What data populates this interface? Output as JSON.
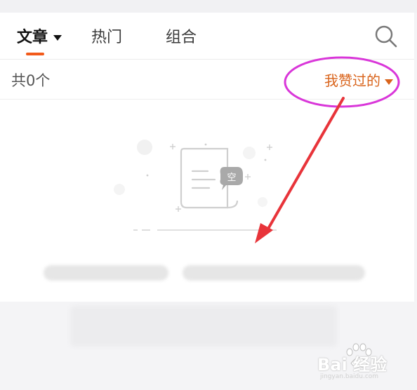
{
  "tabs": [
    {
      "label": "文章",
      "active": true
    },
    {
      "label": "热门",
      "active": false
    },
    {
      "label": "组合",
      "active": false
    }
  ],
  "search": {
    "icon": "search-icon"
  },
  "list": {
    "count_label": "共0个",
    "filter_label": "我赞过的"
  },
  "empty_state": {
    "badge": "空"
  },
  "watermark": {
    "text": "Bai 经验",
    "url": "jingyan.baidu.com"
  },
  "colors": {
    "accent": "#f25a1a",
    "filter": "#d9641c",
    "annotation_ellipse": "#d936d9",
    "annotation_arrow": "#e8343a"
  }
}
